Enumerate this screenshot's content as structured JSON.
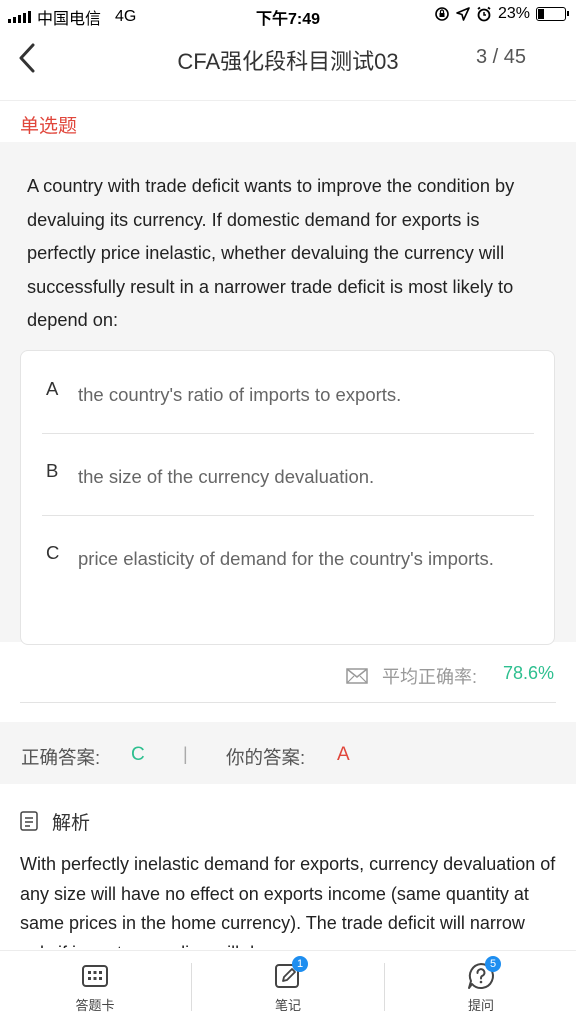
{
  "status_bar": {
    "carrier": "中国电信",
    "network": "4G",
    "time": "下午7:49",
    "battery_text": "23%",
    "battery_level": 0.23
  },
  "nav": {
    "title": "CFA强化段科目测试03",
    "progress": "3 / 45"
  },
  "question": {
    "type": "单选题",
    "text": "A country with trade deficit wants to improve the condition by devaluing its currency. If domestic demand for exports is perfectly price inelastic, whether devaluing the currency will successfully result in a narrower trade deficit is most likely to depend on:",
    "options": [
      {
        "letter": "A",
        "text": "the country's ratio of imports to exports."
      },
      {
        "letter": "B",
        "text": "the size of the currency devaluation."
      },
      {
        "letter": "C",
        "text": "price elasticity of demand for the country's imports."
      }
    ]
  },
  "stats": {
    "accuracy_label": "平均正确率:",
    "accuracy_value": "78.6%"
  },
  "answer": {
    "correct_label": "正确答案:",
    "correct_value": "C",
    "separator": "|",
    "yours_label": "你的答案:",
    "yours_value": "A"
  },
  "analysis": {
    "title": "解析",
    "text": "With perfectly inelastic demand for exports, currency devaluation of any size will have no effect on exports income (same quantity at same prices in the home currency). The trade deficit will narrow only if imports spending will decrease."
  },
  "tabbar": {
    "items": [
      {
        "label": "答题卡",
        "icon": "answer-card-icon"
      },
      {
        "label": "笔记",
        "icon": "notes-icon",
        "badge": "1"
      },
      {
        "label": "提问",
        "icon": "question-icon",
        "badge": "5"
      }
    ]
  },
  "colors": {
    "accent_red": "#e0463b",
    "accent_green": "#2dbf8f",
    "badge_blue": "#1e8ef0"
  }
}
